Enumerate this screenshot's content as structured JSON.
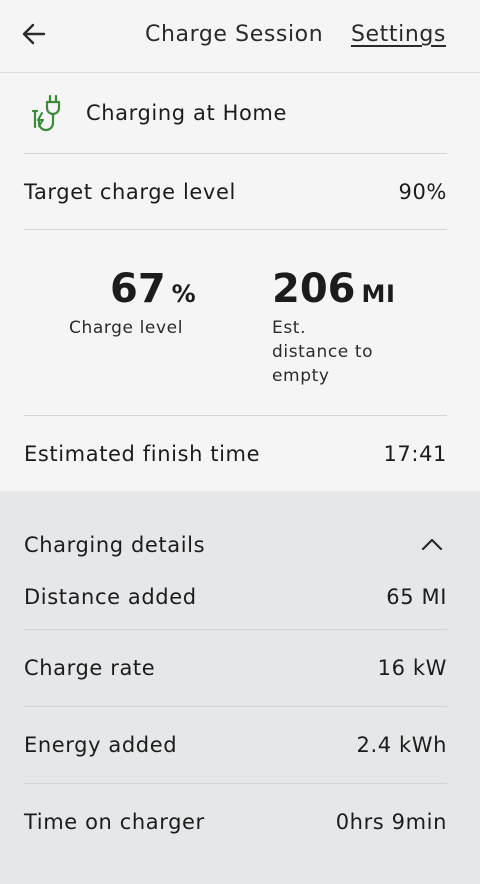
{
  "header": {
    "title": "Charge Session",
    "settings_label": "Settings"
  },
  "location": {
    "label": "Charging at Home"
  },
  "target": {
    "label": "Target charge level",
    "value": "90%"
  },
  "stats": {
    "charge": {
      "value": "67",
      "unit": "%",
      "caption": "Charge level"
    },
    "distance": {
      "value": "206",
      "unit": "MI",
      "caption_lines": [
        "Est.",
        "distance to",
        "empty"
      ]
    }
  },
  "finish": {
    "label": "Estimated finish time",
    "value": "17:41"
  },
  "details": {
    "title": "Charging details",
    "rows": [
      {
        "label": "Distance added",
        "value": "65 MI"
      },
      {
        "label": "Charge rate",
        "value": "16 kW"
      },
      {
        "label": "Energy added",
        "value": "2.4 kWh"
      },
      {
        "label": "Time on charger",
        "value": "0hrs 9min"
      }
    ]
  },
  "icons": {
    "back": "arrow-left-icon",
    "plug": "ev-plug-icon",
    "collapse": "chevron-up-icon"
  },
  "colors": {
    "accent": "#3a8a3a",
    "background": "#f5f5f5",
    "details_bg": "#e6e7e9"
  }
}
